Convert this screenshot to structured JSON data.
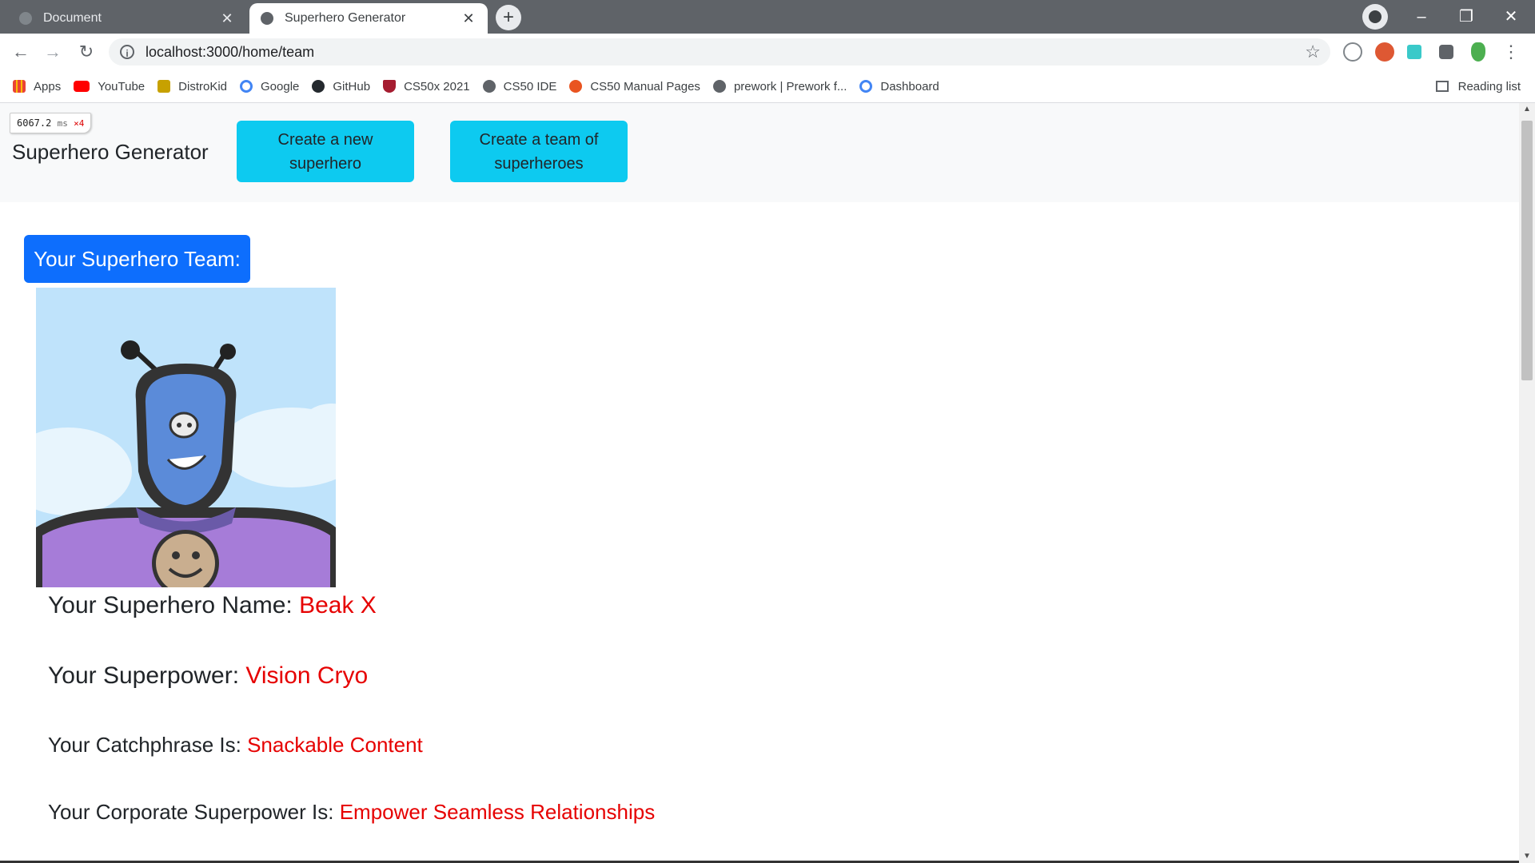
{
  "browser": {
    "tabs": [
      {
        "title": "Document",
        "active": false
      },
      {
        "title": "Superhero Generator",
        "active": true
      }
    ],
    "url": "localhost:3000/home/team",
    "bookmarks": [
      {
        "label": "Apps",
        "icon": "apps-grid-icon",
        "color": "#ea4335"
      },
      {
        "label": "YouTube",
        "icon": "youtube-icon",
        "color": "#ff0000"
      },
      {
        "label": "DistroKid",
        "icon": "distrokid-icon",
        "color": "#c7a100"
      },
      {
        "label": "Google",
        "icon": "google-icon",
        "color": "#4285f4"
      },
      {
        "label": "GitHub",
        "icon": "github-icon",
        "color": "#24292e"
      },
      {
        "label": "CS50x 2021",
        "icon": "harvard-shield-icon",
        "color": "#a51c30"
      },
      {
        "label": "CS50 IDE",
        "icon": "globe-icon",
        "color": "#5f6368"
      },
      {
        "label": "CS50 Manual Pages",
        "icon": "ubuntu-icon",
        "color": "#e95420"
      },
      {
        "label": "prework | Prework f...",
        "icon": "globe-icon",
        "color": "#5f6368"
      },
      {
        "label": "Dashboard",
        "icon": "google-icon",
        "color": "#4285f4"
      }
    ],
    "reading_list": "Reading list"
  },
  "perf": {
    "value": "6067.2",
    "unit": "ms",
    "mult": "×4"
  },
  "navbar": {
    "brand": "Superhero Generator",
    "btn_new": [
      "Create a new",
      "superhero"
    ],
    "btn_team": [
      "Create a team of",
      "superheroes"
    ]
  },
  "team_badge": "Your Superhero Team:",
  "hero": {
    "name_label": "Your Superhero Name: ",
    "name_value": "Beak X",
    "power_label": "Your Superpower: ",
    "power_value": "Vision Cryo",
    "catch_label": "Your Catchphrase Is: ",
    "catch_value": "Snackable Content",
    "corp_label": "Your Corporate Superpower Is: ",
    "corp_value": "Empower Seamless Relationships"
  },
  "colors": {
    "accent_cyan": "#0dcaf0",
    "accent_blue": "#0d6efd",
    "value_red": "#e60000"
  }
}
